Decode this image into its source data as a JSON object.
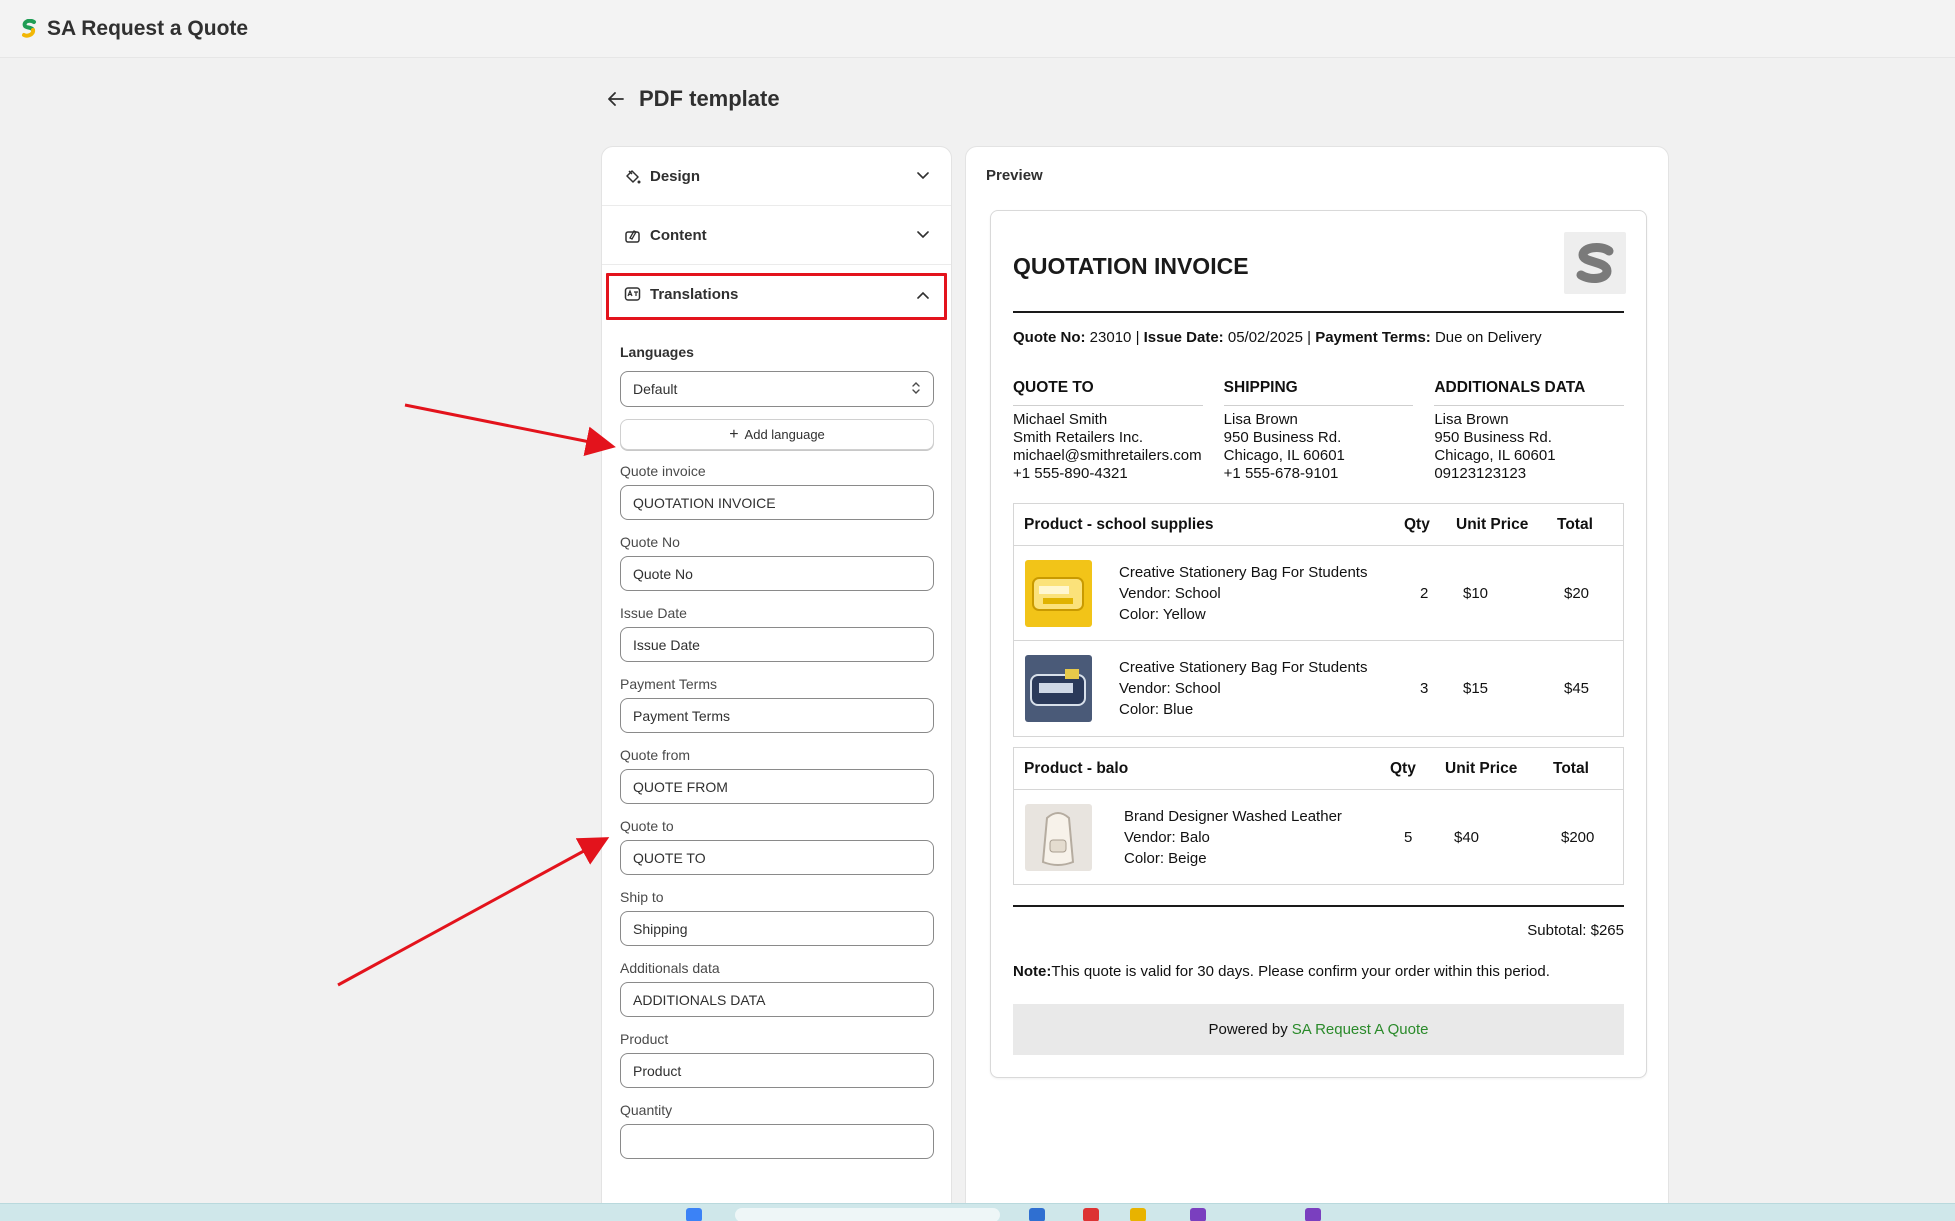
{
  "app": {
    "title": "SA Request a Quote"
  },
  "page": {
    "title": "PDF template"
  },
  "settings": {
    "sections": {
      "design": "Design",
      "content": "Content",
      "translations": "Translations"
    },
    "languages_label": "Languages",
    "language_selected": "Default",
    "add_language": "Add language",
    "fields": [
      {
        "label": "Quote invoice",
        "value": "QUOTATION INVOICE"
      },
      {
        "label": "Quote No",
        "value": "Quote No"
      },
      {
        "label": "Issue Date",
        "value": "Issue Date"
      },
      {
        "label": "Payment Terms",
        "value": "Payment Terms"
      },
      {
        "label": "Quote from",
        "value": "QUOTE FROM"
      },
      {
        "label": "Quote to",
        "value": "QUOTE TO"
      },
      {
        "label": "Ship to",
        "value": "Shipping"
      },
      {
        "label": "Additionals data",
        "value": "ADDITIONALS DATA"
      },
      {
        "label": "Product",
        "value": "Product"
      },
      {
        "label": "Quantity",
        "value": ""
      }
    ]
  },
  "preview": {
    "label": "Preview",
    "doc_title": "QUOTATION INVOICE",
    "meta": {
      "quote_no_label": "Quote No:",
      "quote_no": "23010",
      "issue_date_label": "Issue Date:",
      "issue_date": "05/02/2025",
      "payment_terms_label": "Payment Terms:",
      "payment_terms": "Due on Delivery",
      "sep": "|"
    },
    "quote_to": {
      "heading": "QUOTE TO",
      "lines": [
        "Michael Smith",
        "Smith Retailers Inc.",
        "michael@smithretailers.com",
        "+1 555-890-4321"
      ]
    },
    "shipping": {
      "heading": "SHIPPING",
      "lines": [
        "Lisa Brown",
        "950 Business Rd.",
        "Chicago, IL 60601",
        "+1 555-678-9101"
      ]
    },
    "additional": {
      "heading": "ADDITIONALS DATA",
      "lines": [
        "Lisa Brown",
        "950 Business Rd.",
        "Chicago, IL 60601",
        "09123123123"
      ]
    },
    "tables": [
      {
        "header": "Product - school supplies",
        "qty": "Qty",
        "unit_price": "Unit Price",
        "total": "Total",
        "rows": [
          {
            "name": "Creative Stationery Bag For Students",
            "vendor": "Vendor: School",
            "color": "Color: Yellow",
            "qty": "2",
            "unit_price": "$10",
            "total": "$20",
            "thumb": "yellow"
          },
          {
            "name": "Creative Stationery Bag For Students",
            "vendor": "Vendor: School",
            "color": "Color: Blue",
            "qty": "3",
            "unit_price": "$15",
            "total": "$45",
            "thumb": "blue"
          }
        ]
      },
      {
        "header": "Product - balo",
        "qty": "Qty",
        "unit_price": "Unit Price",
        "total": "Total",
        "rows": [
          {
            "name": "Brand Designer Washed Leather",
            "vendor": "Vendor: Balo",
            "color": "Color: Beige",
            "qty": "5",
            "unit_price": "$40",
            "total": "$200",
            "thumb": "beige"
          }
        ]
      }
    ],
    "subtotal": "Subtotal: $265",
    "note_label": "Note:",
    "note_text": "This quote is valid for 30 days. Please confirm your order within this period.",
    "powered_by": "Powered by",
    "powered_link": "SA Request A Quote"
  },
  "colors": {
    "highlight": "#e3131c",
    "link": "#2a8a2a",
    "brand_green": "#1f9d55",
    "brand_yellow": "#f2b705"
  }
}
